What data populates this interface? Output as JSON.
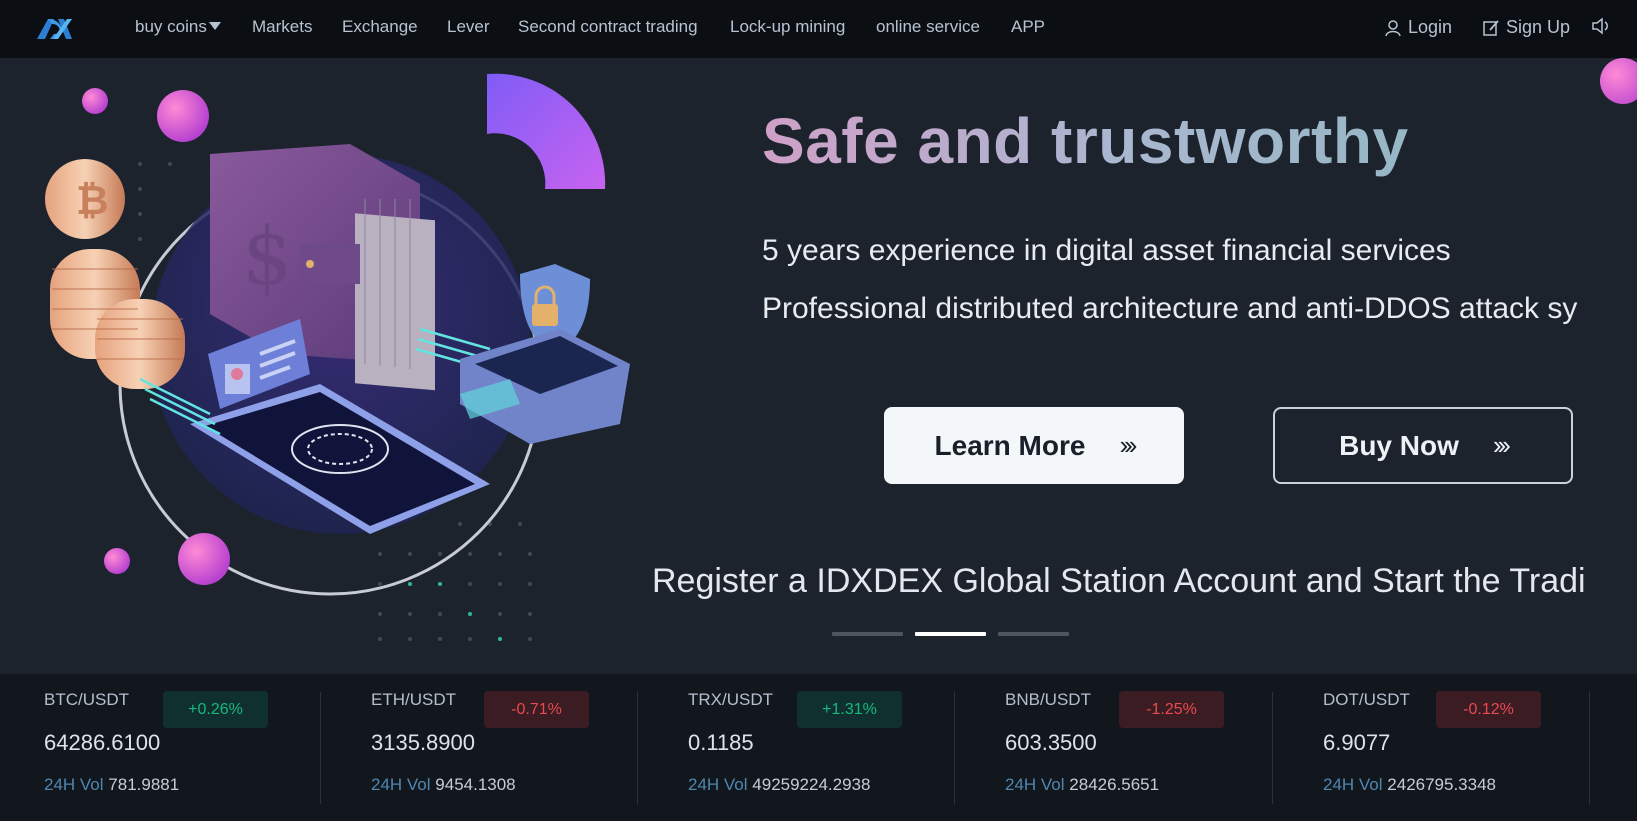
{
  "nav": {
    "logo": "DX",
    "items": [
      {
        "label": "buy coins",
        "has_dropdown": true
      },
      {
        "label": "Markets"
      },
      {
        "label": "Exchange"
      },
      {
        "label": "Lever"
      },
      {
        "label": "Second contract trading"
      },
      {
        "label": "Lock-up mining"
      },
      {
        "label": "online service"
      },
      {
        "label": "APP"
      }
    ],
    "login_label": "Login",
    "signup_label": "Sign Up",
    "sound_icon": "speaker-icon"
  },
  "hero": {
    "title": "Safe and trustworthy",
    "line1": "5 years experience in digital asset financial services",
    "line2": "Professional distributed architecture and anti-DDOS attack sy",
    "learn_more_label": "Learn More",
    "buy_now_label": "Buy Now",
    "arrows": "›››",
    "register_text": "Register a IDXDEX Global Station Account and Start the Tradi",
    "slides": 3,
    "active_slide": 1
  },
  "ticker": {
    "vol_label": "24H Vol",
    "items": [
      {
        "pair": "BTC/USDT",
        "change": "+0.26%",
        "direction": "up",
        "price": "64286.6100",
        "vol": "781.9881"
      },
      {
        "pair": "ETH/USDT",
        "change": "-0.71%",
        "direction": "down",
        "price": "3135.8900",
        "vol": "9454.1308"
      },
      {
        "pair": "TRX/USDT",
        "change": "+1.31%",
        "direction": "up",
        "price": "0.1185",
        "vol": "49259224.2938"
      },
      {
        "pair": "BNB/USDT",
        "change": "-1.25%",
        "direction": "down",
        "price": "603.3500",
        "vol": "28426.5651"
      },
      {
        "pair": "DOT/USDT",
        "change": "-0.12%",
        "direction": "down",
        "price": "6.9077",
        "vol": "2426795.3348"
      }
    ]
  },
  "colors": {
    "up": "#17b780",
    "down": "#e84a4f",
    "accent": "#a15cf5"
  }
}
